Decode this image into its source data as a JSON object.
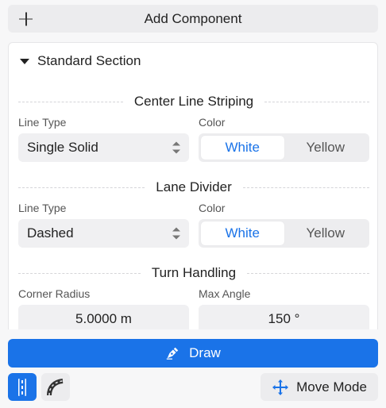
{
  "add_component": {
    "label": "Add Component",
    "icon": "plus-icon"
  },
  "section": {
    "title": "Standard Section",
    "icon": "caret-down-icon"
  },
  "center_line": {
    "heading": "Center Line Striping",
    "line_type_label": "Line Type",
    "line_type_value": "Single Solid",
    "color_label": "Color",
    "color_options": [
      "White",
      "Yellow"
    ],
    "color_selected": "White"
  },
  "lane_divider": {
    "heading": "Lane Divider",
    "line_type_label": "Line Type",
    "line_type_value": "Dashed",
    "color_label": "Color",
    "color_options": [
      "White",
      "Yellow"
    ],
    "color_selected": "White"
  },
  "turn_handling": {
    "heading": "Turn Handling",
    "corner_radius_label": "Corner Radius",
    "corner_radius_value": "5.0000 m",
    "max_angle_label": "Max Angle",
    "max_angle_value": "150 °"
  },
  "draw_button": {
    "label": "Draw",
    "icon": "pen-icon"
  },
  "tools": [
    {
      "icon": "straight-road-icon",
      "active": true
    },
    {
      "icon": "curved-road-icon",
      "active": false
    }
  ],
  "move_mode": {
    "label": "Move Mode",
    "icon": "move-arrows-icon"
  },
  "colors": {
    "accent": "#1a73e8",
    "panel_bg": "#ffffff",
    "control_bg": "#f0f0f2"
  }
}
